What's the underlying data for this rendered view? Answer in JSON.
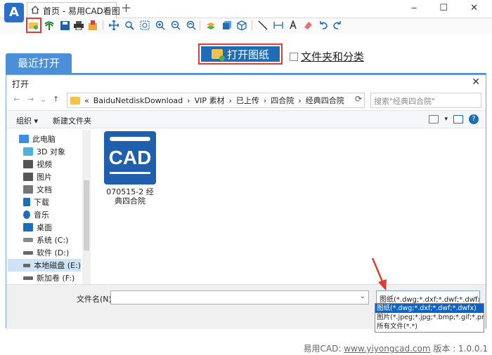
{
  "titlebar": {
    "tab_label": "首页 - 易用CAD看图",
    "add_tab": "+",
    "logo_letter": "A",
    "window_controls": "‒ ☐ ✕"
  },
  "toolbar": {
    "icons": [
      "open-file-icon",
      "palm-tree-icon",
      "save-icon",
      "print-icon",
      "export-icon",
      "pan-icon",
      "zoom-window-icon",
      "zoom-extents-icon",
      "zoom-in-icon",
      "zoom-out-icon",
      "zoom-previous-icon",
      "layer-icon",
      "3d-cube-icon",
      "3d-box-icon",
      "line-icon",
      "dimension-icon",
      "text-icon",
      "erase-icon",
      "undo-icon",
      "redo-icon"
    ]
  },
  "main": {
    "open_button": "打开图纸",
    "category_checkbox": "文件夹和分类",
    "recent_tab": "最近打开"
  },
  "dialog": {
    "title": "打开",
    "close": "✕",
    "path": [
      "«",
      "BaiduNetdiskDownload",
      "›",
      "VIP 素材",
      "›",
      "已上传",
      "›",
      "四合院",
      "›",
      "经典四合院"
    ],
    "search_placeholder": "搜索\"经典四合院\"",
    "organize": "组织 ▾",
    "new_folder": "新建文件夹",
    "sidebar": [
      {
        "label": "此电脑",
        "icon": "computer-icon",
        "color": "#3a8ee6"
      },
      {
        "label": "3D 对象",
        "icon": "cube-icon",
        "color": "#4fb3d9"
      },
      {
        "label": "视频",
        "icon": "video-icon",
        "color": "#555555"
      },
      {
        "label": "图片",
        "icon": "picture-icon",
        "color": "#555555"
      },
      {
        "label": "文档",
        "icon": "document-icon",
        "color": "#777777"
      },
      {
        "label": "下载",
        "icon": "download-icon",
        "color": "#1f6db5"
      },
      {
        "label": "音乐",
        "icon": "music-icon",
        "color": "#1f6db5"
      },
      {
        "label": "桌面",
        "icon": "desktop-icon",
        "color": "#1f6db5"
      },
      {
        "label": "系统 (C:)",
        "icon": "drive-icon",
        "color": "#888888"
      },
      {
        "label": "软件 (D:)",
        "icon": "drive-icon",
        "color": "#666666"
      },
      {
        "label": "本地磁盘 (E:)",
        "icon": "drive-icon",
        "color": "#666666"
      },
      {
        "label": "新加卷 (F:)",
        "icon": "drive-icon",
        "color": "#666666"
      }
    ],
    "selected_sidebar": "本地磁盘 (E:)",
    "file": {
      "name": "070515-2 经典四合院",
      "icon_text": "CAD"
    },
    "filename_label": "文件名(N):",
    "filetype_selected": "图纸(*.dwg;*.dxf;*.dwf;*.dwfx)",
    "filetype_options": [
      "图纸(*.dwg;*.dxf;*.dwf;*.dwfx)",
      "图片(*.jpeg;*.jpg;*.bmp;*.gif;*.png)",
      "所有文件(*.*)"
    ]
  },
  "footer": {
    "prefix": "易用CAD:",
    "url": "www.yiyongcad.com",
    "version": "版本 : 1.0.0.1"
  },
  "colors": {
    "accent": "#1f6db5",
    "highlight": "#e53935",
    "tab_blue": "#4b8fd8"
  }
}
